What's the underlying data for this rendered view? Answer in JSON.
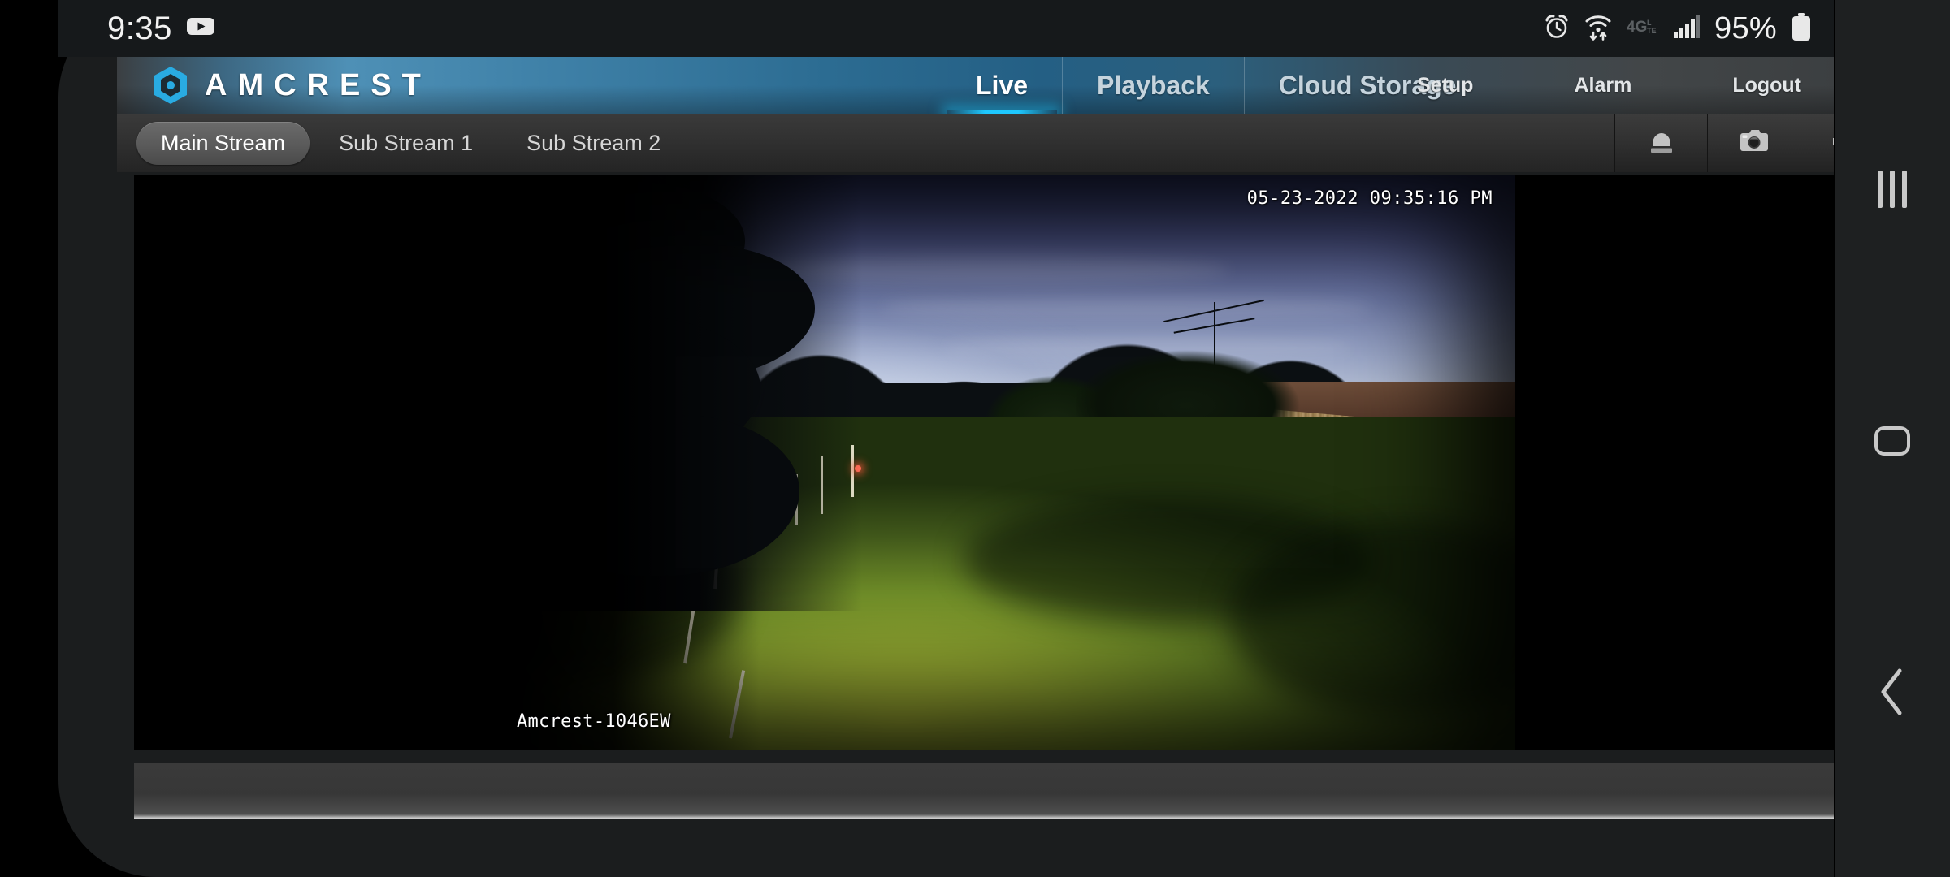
{
  "status_bar": {
    "clock": "9:35",
    "battery_percent": "95%",
    "icons": [
      "youtube-icon",
      "alarm-icon",
      "wifi-icon",
      "4glte-icon",
      "signal-icon",
      "battery-icon"
    ],
    "network_label": "4G"
  },
  "header": {
    "brand": "AMCREST",
    "logo_icon": "amcrest-shield-icon",
    "accent_color": "#29abe2",
    "primary_nav": [
      {
        "label": "Live",
        "active": true
      },
      {
        "label": "Playback",
        "active": false
      },
      {
        "label": "Cloud Storage",
        "active": false
      }
    ],
    "secondary_nav": [
      {
        "label": "Setup"
      },
      {
        "label": "Alarm"
      },
      {
        "label": "Logout"
      }
    ]
  },
  "stream_bar": {
    "tabs": [
      {
        "label": "Main Stream",
        "active": true
      },
      {
        "label": "Sub Stream 1",
        "active": false
      },
      {
        "label": "Sub Stream 2",
        "active": false
      }
    ],
    "actions": [
      {
        "name": "record-button",
        "icon": "record-dome-icon"
      },
      {
        "name": "snapshot-button",
        "icon": "camera-icon"
      },
      {
        "name": "audio-mute-button",
        "icon": "speaker-muted-icon"
      }
    ]
  },
  "video": {
    "timestamp": "05-23-2022 09:35:16 PM",
    "camera_name": "Amcrest-1046EW",
    "scene": "night-backyard-lawn-fence-garage"
  },
  "android_nav": {
    "recents": "recent-apps-icon",
    "home": "home-icon",
    "back": "back-icon"
  }
}
